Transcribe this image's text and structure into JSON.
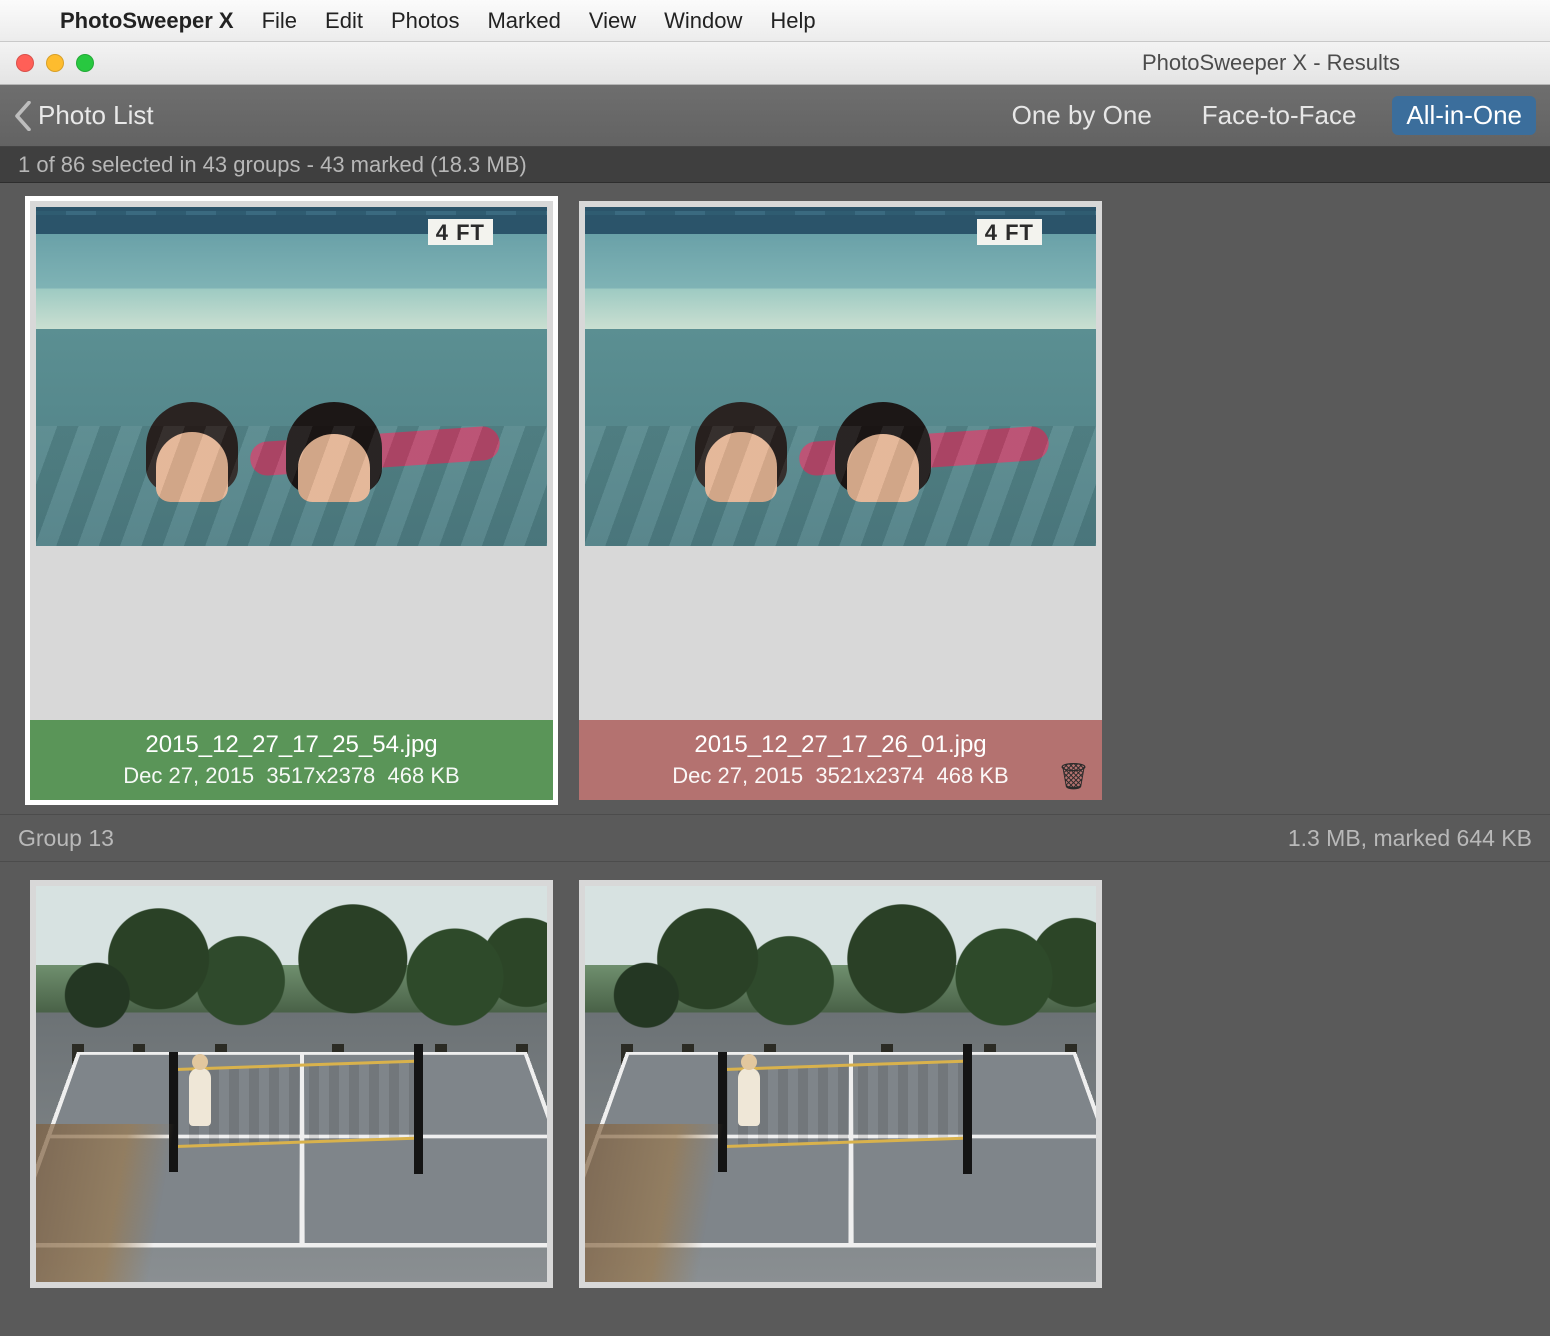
{
  "menubar": {
    "app": "PhotoSweeper X",
    "items": [
      "File",
      "Edit",
      "Photos",
      "Marked",
      "View",
      "Window",
      "Help"
    ]
  },
  "window": {
    "title": "PhotoSweeper X - Results"
  },
  "toolbar": {
    "back_label": "Photo List",
    "views": {
      "one": "One by One",
      "face": "Face-to-Face",
      "all": "All-in-One"
    }
  },
  "status": "1 of 86 selected in 43 groups - 43 marked (18.3 MB)",
  "group1": {
    "photos": [
      {
        "filename": "2015_12_27_17_25_54.jpg",
        "date": "Dec 27, 2015",
        "dimensions": "3517x2378",
        "size": "468 KB",
        "depth_label": "4 FT",
        "state": "keep"
      },
      {
        "filename": "2015_12_27_17_26_01.jpg",
        "date": "Dec 27, 2015",
        "dimensions": "3521x2374",
        "size": "468 KB",
        "depth_label": "4 FT",
        "state": "mark"
      }
    ]
  },
  "group2": {
    "label": "Group 13",
    "summary": "1.3 MB, marked 644 KB"
  }
}
